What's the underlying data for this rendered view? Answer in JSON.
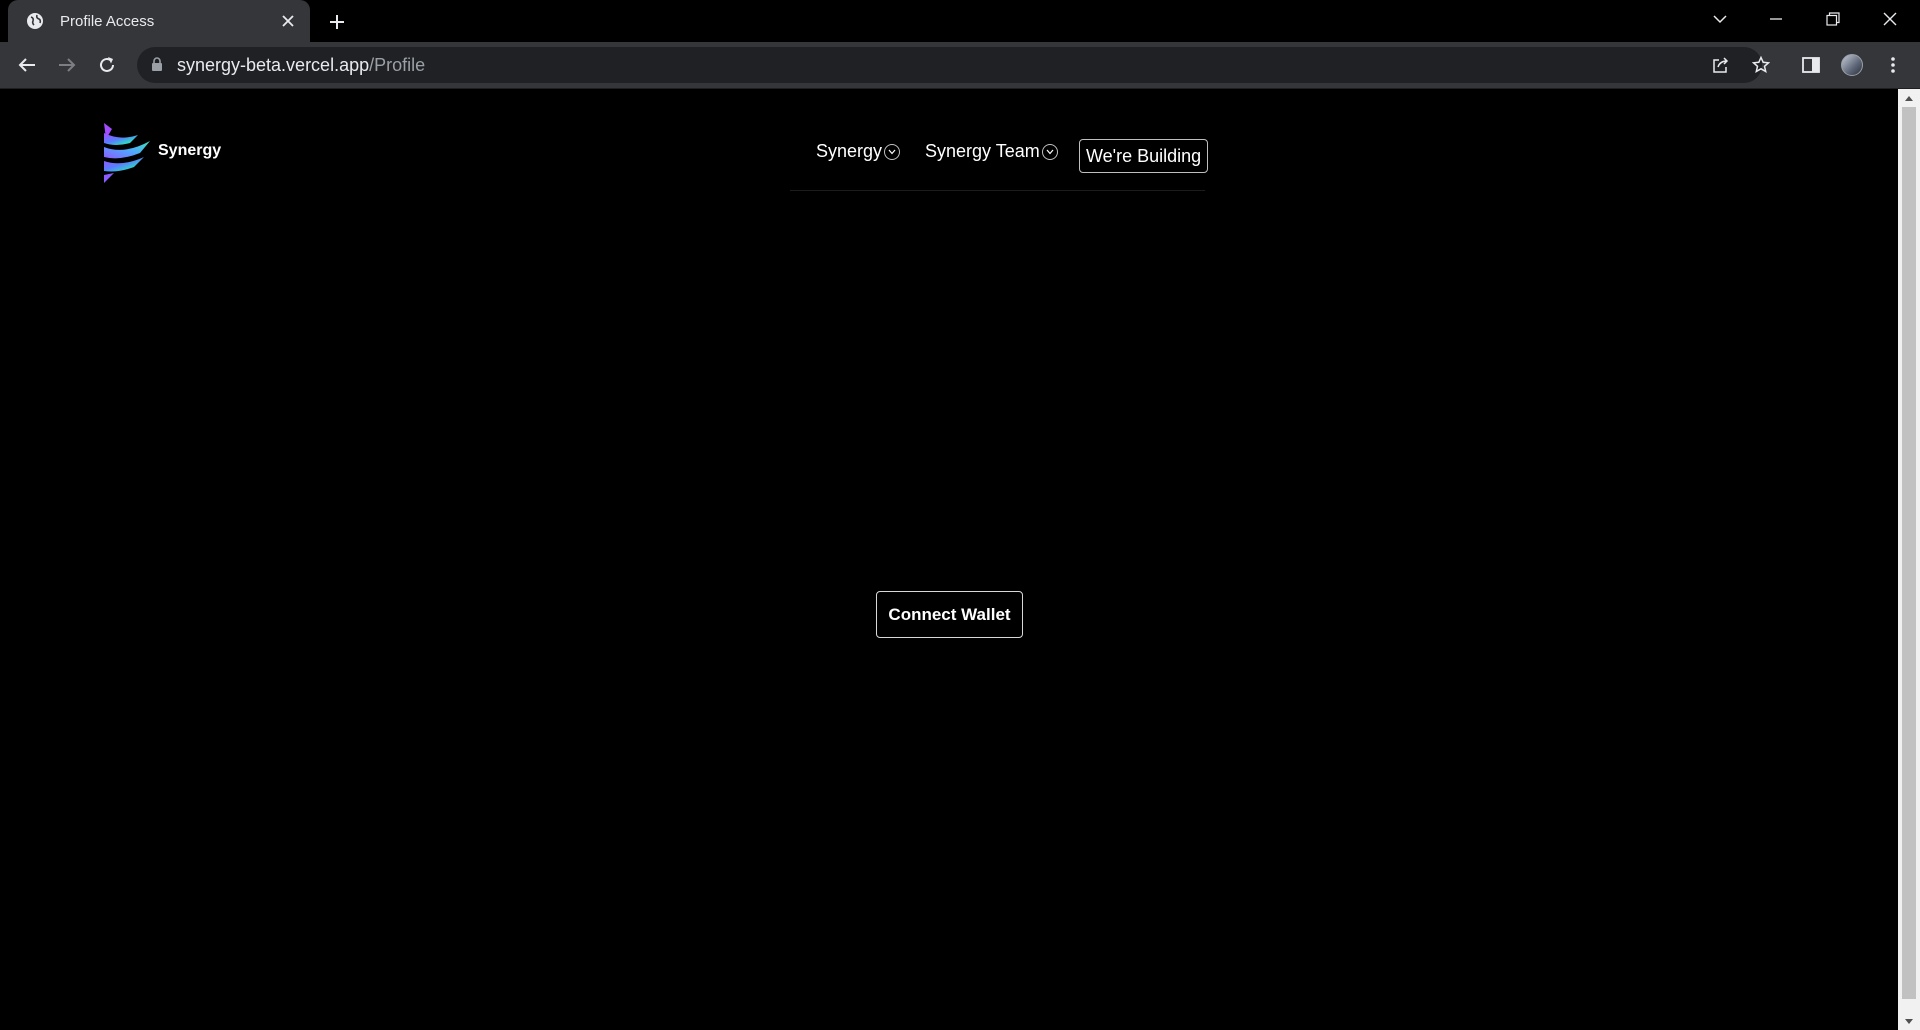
{
  "browser": {
    "tab": {
      "title": "Profile Access"
    },
    "address": {
      "domain": "synergy-beta.vercel.app",
      "path": "/Profile"
    }
  },
  "page": {
    "logo_text": "Synergy",
    "nav": {
      "synergy_label": "Synergy",
      "team_label": "Synergy Team",
      "building_label": "We're Building"
    },
    "connect_label": "Connect Wallet"
  },
  "icons": {
    "tab_favicon": "globe-icon",
    "tab_close": "close-icon",
    "new_tab": "plus-icon",
    "tab_search": "chevron-down-icon",
    "minimize": "minimize-icon",
    "restore": "restore-icon",
    "close_window": "close-icon",
    "back": "arrow-left-icon",
    "forward": "arrow-right-icon",
    "reload": "reload-icon",
    "lock": "lock-icon",
    "share": "share-icon",
    "bookmark": "star-icon",
    "side_panel": "side-panel-icon",
    "profile": "avatar",
    "menu": "kebab-menu-icon"
  },
  "colors": {
    "chrome_bg": "#35363a",
    "omnibox_bg": "#202124",
    "page_bg": "#000000",
    "text": "#ffffff",
    "logo_gradient": [
      "#a34bff",
      "#5b7cff",
      "#2fd6c8",
      "#4be08a"
    ]
  }
}
